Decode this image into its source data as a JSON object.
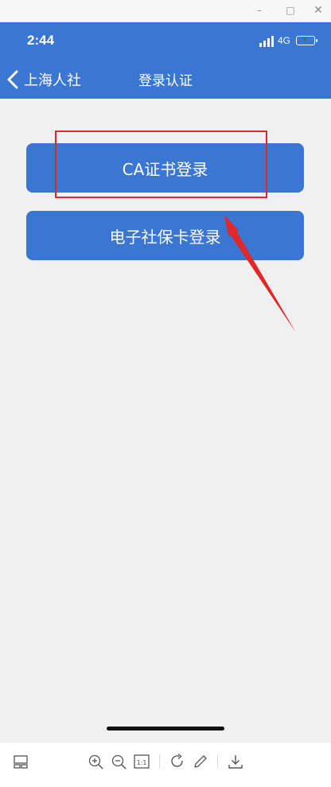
{
  "window": {
    "minimize_glyph": "–",
    "maximize_glyph": "□",
    "close_glyph": "✕"
  },
  "status_bar": {
    "time": "2:44",
    "network": "4G",
    "battery_level": 0.0,
    "charging": true
  },
  "nav": {
    "back_label": "上海人社",
    "title": "登录认证"
  },
  "buttons": {
    "ca_login": "CA证书登录",
    "social_card_login": "电子社保卡登录"
  },
  "annotation": {
    "highlight_color": "#e0282a",
    "arrow_color": "#e0282a"
  },
  "toolbar": {
    "icons": [
      "thumbnail-icon",
      "zoom-in-icon",
      "zoom-out-icon",
      "actual-size-icon",
      "rotate-icon",
      "edit-icon",
      "download-icon"
    ],
    "actual_size_label": "1:1"
  },
  "colors": {
    "brand_blue": "#3a76d2",
    "background": "#f0f0f0"
  }
}
